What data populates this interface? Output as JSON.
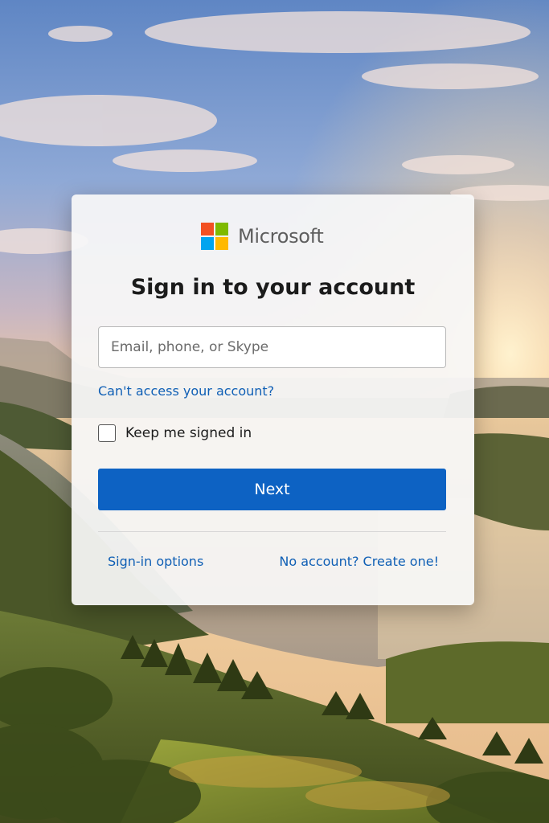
{
  "brand": {
    "name": "Microsoft",
    "logo_colors": [
      "#f25022",
      "#7fba00",
      "#00a4ef",
      "#ffb900"
    ]
  },
  "signin": {
    "title": "Sign in to your account",
    "email_placeholder": "Email, phone, or Skype",
    "email_value": "",
    "cant_access_link": "Can't access your account?",
    "keep_signed_in_label": "Keep me signed in",
    "keep_signed_in_checked": false,
    "next_button": "Next",
    "signin_options_link": "Sign-in options",
    "create_account_link": "No account? Create one!"
  },
  "theme": {
    "accent": "#0d62c3",
    "link": "#0f5fb5"
  }
}
